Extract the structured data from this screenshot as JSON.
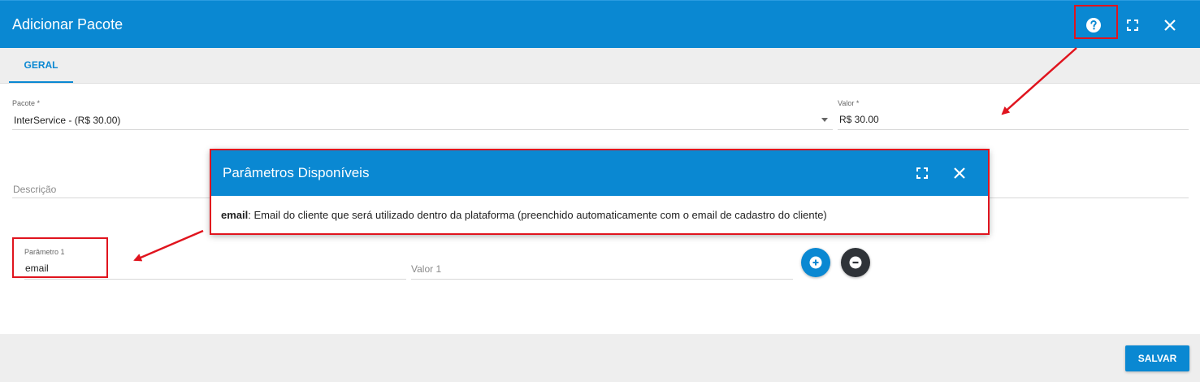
{
  "dialog": {
    "title": "Adicionar Pacote",
    "icons": [
      "help-icon",
      "expand-icon",
      "close-icon"
    ]
  },
  "tabs": [
    {
      "label": "GERAL",
      "active": true
    }
  ],
  "form": {
    "pacote": {
      "label": "Pacote *",
      "value": "InterService - (R$ 30.00)"
    },
    "valor": {
      "label": "Valor *",
      "value": "R$ 30.00"
    },
    "descricao": {
      "placeholder": "Descrição"
    },
    "parametro1": {
      "label": "Parâmetro 1",
      "value": "email"
    },
    "valor1": {
      "placeholder": "Valor 1"
    }
  },
  "footer": {
    "save_label": "SALVAR"
  },
  "popup": {
    "title": "Parâmetros Disponíveis",
    "param_name": "email",
    "param_desc": ": Email do cliente que será utilizado dentro da plataforma (preenchido automaticamente com o email de cadastro do cliente)"
  },
  "colors": {
    "primary": "#0a88d2",
    "annotation": "#e0141e",
    "remove_button": "#2f3338",
    "tab_bar": "#eeeeee"
  }
}
